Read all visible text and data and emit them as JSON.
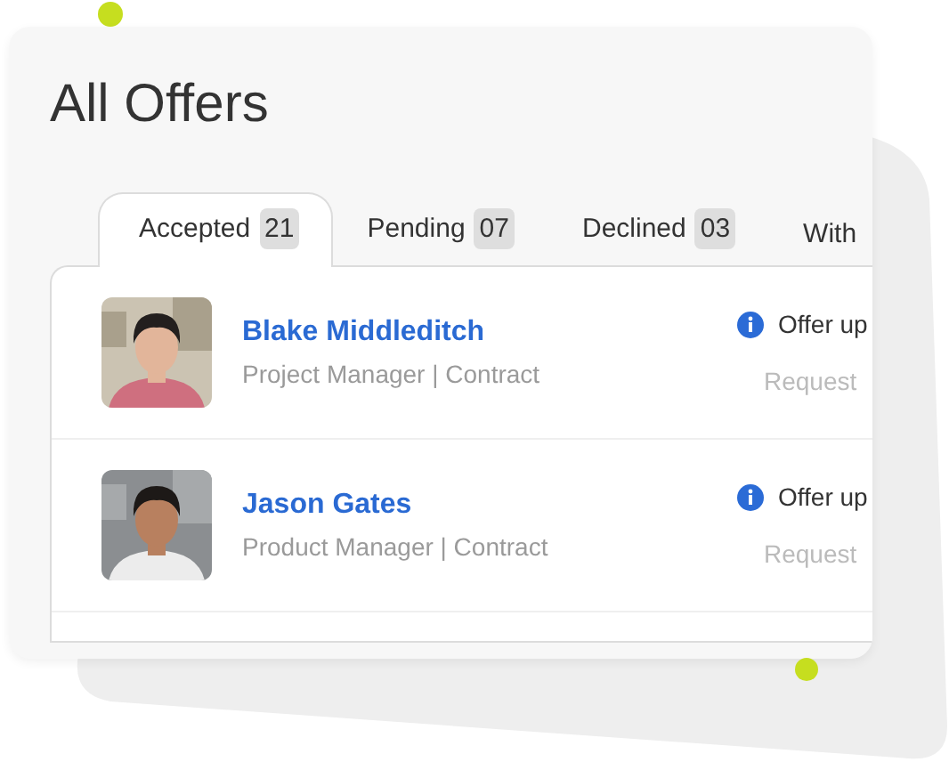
{
  "title": "All Offers",
  "tabs": [
    {
      "label": "Accepted",
      "count": "21",
      "selected": true
    },
    {
      "label": "Pending",
      "count": "07",
      "selected": false
    },
    {
      "label": "Declined",
      "count": "03",
      "selected": false
    },
    {
      "label": "With",
      "selected": false
    }
  ],
  "offers": [
    {
      "name": "Blake Middleditch",
      "role": "Project Manager | Contract",
      "status": "Offer up",
      "note": "Request"
    },
    {
      "name": "Jason Gates",
      "role": "Product Manager | Contract",
      "status": "Offer up",
      "note": "Request"
    }
  ]
}
